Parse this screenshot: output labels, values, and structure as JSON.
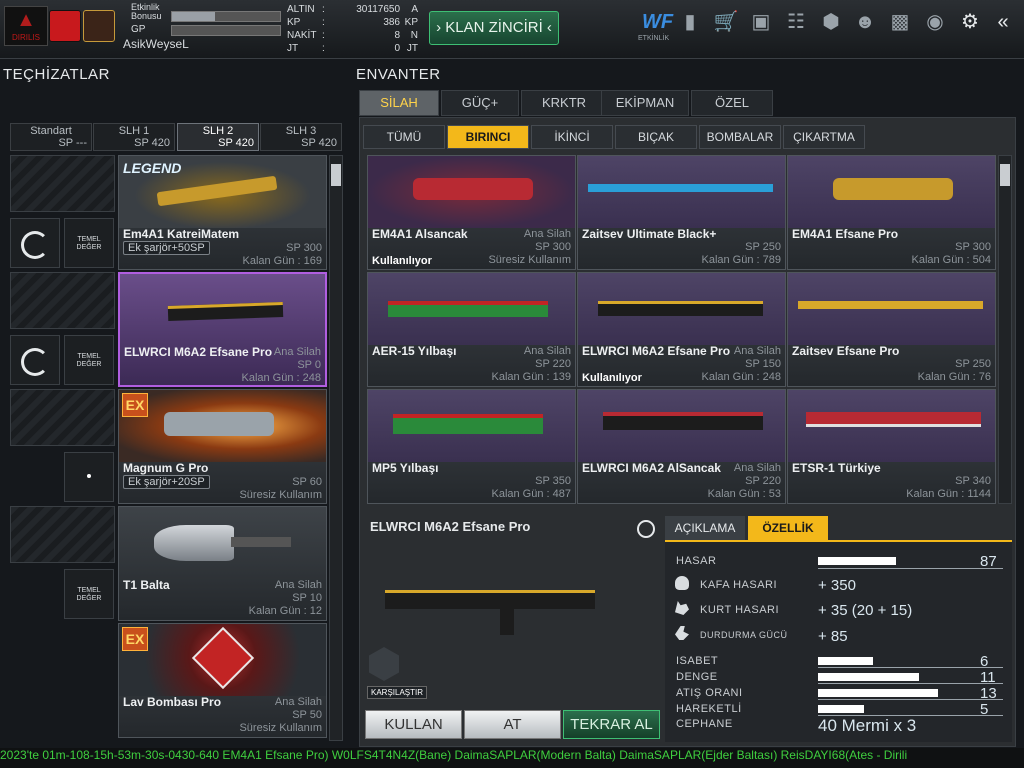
{
  "topbar": {
    "bonus_label": "Etkinlik Bonusu",
    "bonus_fill": 0.4,
    "gp_label": "GP",
    "gp_fill": 0,
    "username": "AsikWeyseL",
    "logo_text": "DIRILIS",
    "currencies": [
      {
        "label": "ALTIN",
        "value": "30117650",
        "unit": "A"
      },
      {
        "label": "KP",
        "value": "386",
        "unit": "KP"
      },
      {
        "label": "NAKİT",
        "value": "8",
        "unit": "N"
      },
      {
        "label": "JT",
        "value": "0",
        "unit": "JT"
      }
    ],
    "klan_button": "KLAN ZİNCİRİ",
    "etkinlik_label": "ETKİNLİK",
    "icons": [
      "etkinlik-icon",
      "ranking-icon",
      "shop-icon",
      "inventory-bag-icon",
      "medals-icon",
      "box-icon",
      "friends-icon",
      "stats-icon",
      "globe-icon",
      "settings-gear-icon",
      "back-arrow-icon"
    ]
  },
  "equipment": {
    "title": "TEÇHİZATLAR",
    "slots": [
      {
        "name": "Standart",
        "sp": "SP ---"
      },
      {
        "name": "SLH 1",
        "sp": "SP 420"
      },
      {
        "name": "SLH 2",
        "sp": "SP 420"
      },
      {
        "name": "SLH 3",
        "sp": "SP 420"
      }
    ],
    "temel_label": "TEMEL DEĞER",
    "items": [
      {
        "name": "Em4A1 KatreiMatem",
        "tag": "Ek şarjör+50SP",
        "sp": "SP 300",
        "days": "Kalan Gün : 169",
        "badge": "LEGEND"
      },
      {
        "name": "ELWRCI M6A2 Efsane Pro",
        "type": "Ana Silah",
        "sp": "SP 0",
        "days": "Kalan Gün : 248"
      },
      {
        "name": "Magnum G Pro",
        "tag": "Ek şarjör+20SP",
        "sp": "SP 60",
        "days": "Süresiz Kullanım",
        "ex": "EX"
      },
      {
        "name": "T1 Balta",
        "type": "Ana Silah",
        "sp": "SP 10",
        "days": "Kalan Gün : 12"
      },
      {
        "name": "Lav Bombası Pro",
        "type": "Ana Silah",
        "sp": "SP 50",
        "days": "Süresiz Kullanım",
        "ex": "EX"
      }
    ]
  },
  "inventory": {
    "title": "ENVANTER",
    "tabs": [
      "SİLAH",
      "GÜÇ+",
      "KRKTR",
      "EKİPMAN",
      "ÖZEL"
    ],
    "subtabs": [
      "TÜMÜ",
      "BIRINCI",
      "İKİNCİ",
      "BIÇAK",
      "BOMBALAR",
      "ÇIKARTMA"
    ],
    "items": [
      {
        "name": "EM4A1 Alsancak",
        "type": "Ana Silah",
        "sp": "SP 300",
        "days": "Süresiz Kullanım",
        "status": "Kullanılıyor"
      },
      {
        "name": "Zaitsev Ultimate Black+",
        "type": "",
        "sp": "SP 250",
        "days": "Kalan Gün : 789",
        "status": ""
      },
      {
        "name": "EM4A1 Efsane Pro",
        "type": "",
        "sp": "SP 300",
        "days": "Kalan Gün : 504",
        "status": ""
      },
      {
        "name": "AER-15 Yılbaşı",
        "type": "Ana Silah",
        "sp": "SP 220",
        "days": "Kalan Gün : 139",
        "status": ""
      },
      {
        "name": "ELWRCI M6A2 Efsane Pro",
        "type": "Ana Silah",
        "sp": "SP 150",
        "days": "Kalan Gün : 248",
        "status": "Kullanılıyor"
      },
      {
        "name": "Zaitsev Efsane Pro",
        "type": "",
        "sp": "SP 250",
        "days": "Kalan Gün : 76",
        "status": ""
      },
      {
        "name": "MP5 Yılbaşı",
        "type": "",
        "sp": "SP 350",
        "days": "Kalan Gün : 487",
        "status": ""
      },
      {
        "name": "ELWRCI M6A2 AlSancak",
        "type": "Ana Silah",
        "sp": "SP 220",
        "days": "Kalan Gün : 53",
        "status": ""
      },
      {
        "name": "ETSR-1 Türkiye",
        "type": "",
        "sp": "SP 340",
        "days": "Kalan Gün : 1144",
        "status": ""
      }
    ]
  },
  "detail": {
    "name": "ELWRCI M6A2 Efsane Pro",
    "tabs": [
      "AÇIKLAMA",
      "ÖZELLİK"
    ],
    "compare_label": "KARŞILAŞTIR",
    "stats_main": {
      "label": "HASAR",
      "value": "87",
      "fill": 0.87
    },
    "stats_special": [
      {
        "label": "KAFA HASARI",
        "value": "+ 350",
        "icon": "skull-icon"
      },
      {
        "label": "KURT HASARI",
        "value": "+ 35 (20 + 15)",
        "icon": "wolf-icon"
      },
      {
        "label": "DURDURMA GÜCÜ",
        "value": "+ 85",
        "icon": "stop-power-icon"
      }
    ],
    "stats_bars": [
      {
        "label": "ISABET",
        "value": "6",
        "fill": 0.29
      },
      {
        "label": "DENGE",
        "value": "11",
        "fill": 0.53
      },
      {
        "label": "ATIŞ ORANI",
        "value": "13",
        "fill": 0.63
      },
      {
        "label": "HAREKETLİ",
        "value": "5",
        "fill": 0.24
      }
    ],
    "ammo": {
      "label": "CEPHANE",
      "value": "40 Mermi x 3"
    },
    "buttons": {
      "use": "KULLAN",
      "drop": "AT",
      "rebuy": "TEKRAR AL"
    }
  },
  "ticker": "2023'te 01m-108-15h-53m-30s-0430-640   EM4A1 Efsane Pro)   W0LFS4T4N4Z(Bane)   DaimaSAPLAR(Modern Balta)   DaimaSAPLAR(Ejder Baltası)   ReisDAYI68(Ates - Dirili",
  "colors": {
    "accent_yellow": "#f3b81a",
    "selected_purple": "#b05ee0",
    "klan_green": "#2b6f4b",
    "ticker_green": "#3fcf3f"
  }
}
